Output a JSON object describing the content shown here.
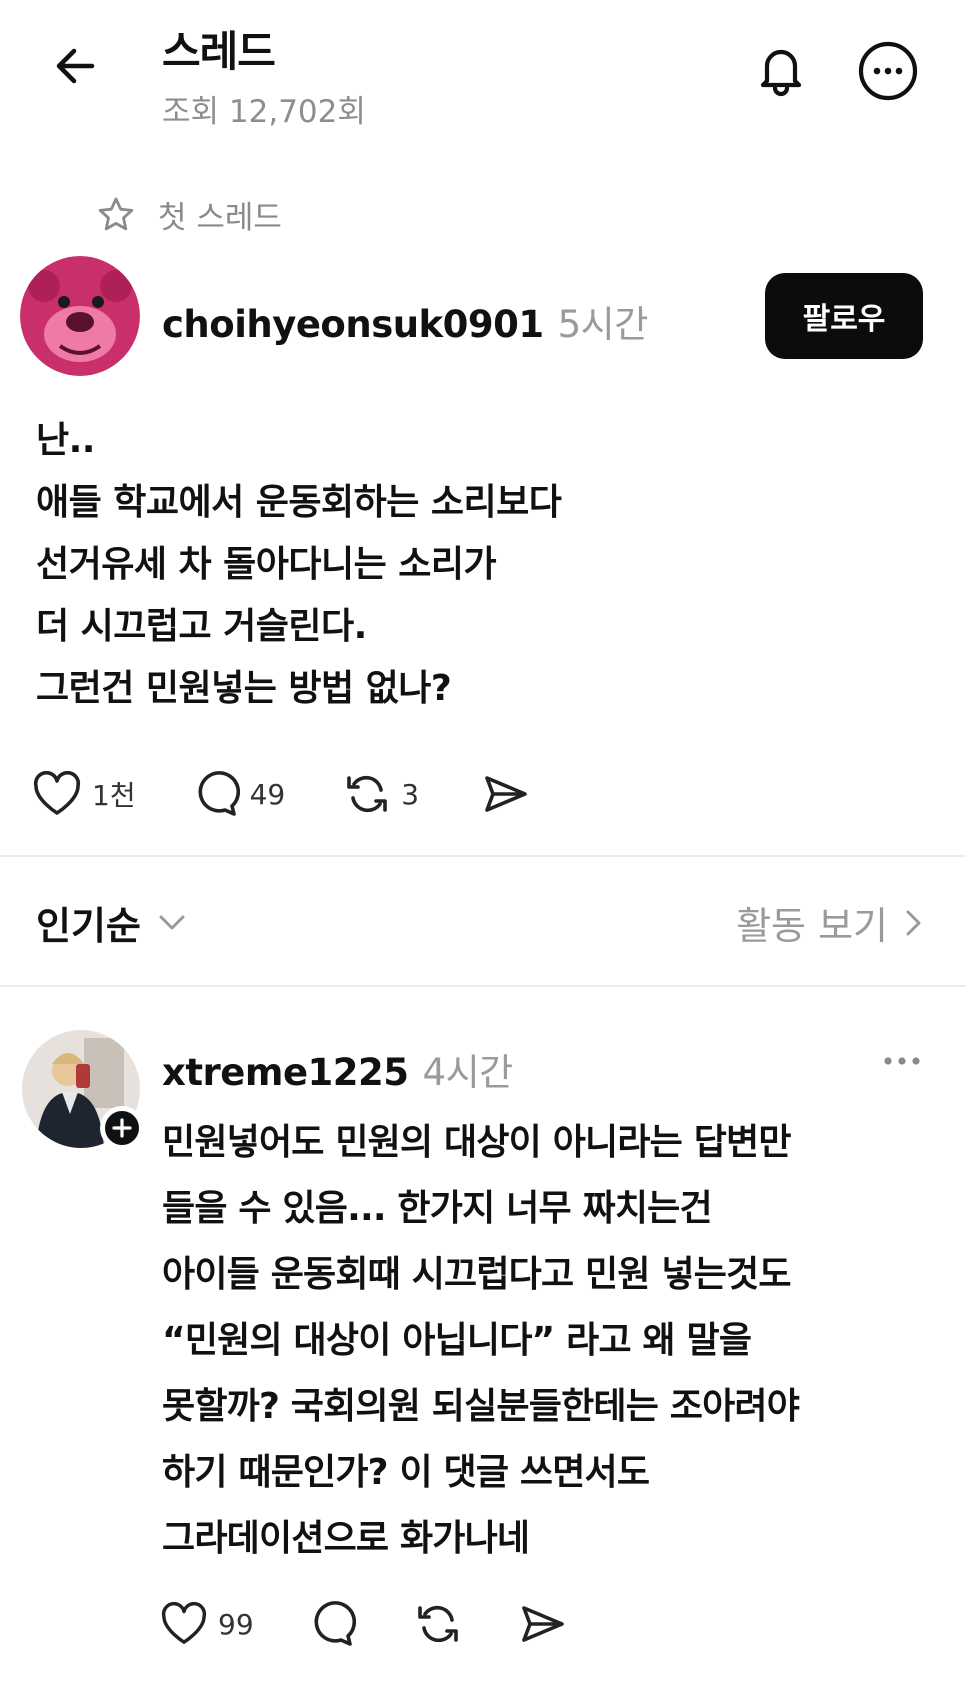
{
  "header": {
    "title": "스레드",
    "views": "조회 12,702회"
  },
  "first_thread": {
    "label": "첫 스레드"
  },
  "post": {
    "username": "choihyeonsuk0901",
    "time": "5시간",
    "follow_label": "팔로우",
    "lines": [
      "난..",
      "애들 학교에서 운동회하는 소리보다",
      "선거유세 차 돌아다니는 소리가",
      "더 시끄럽고 거슬린다.",
      "그런건 민원넣는 방법 없나?"
    ],
    "likes": "1천",
    "comments": "49",
    "reposts": "3"
  },
  "sort": {
    "label": "인기순",
    "activity_label": "활동 보기"
  },
  "reply": {
    "username": "xtreme1225",
    "time": "4시간",
    "lines": [
      "민원넣어도 민원의 대상이 아니라는 답변만",
      "들을 수 있음... 한가지 너무 짜치는건",
      "아이들 운동회때 시끄럽다고 민원 넣는것도",
      "“민원의 대상이 아닙니다”  라고 왜 말을",
      "못할까? 국회의원 되실분들한테는 조아려야",
      "하기 때문인가? 이 댓글 쓰면서도",
      "그라데이션으로 화가나네"
    ],
    "likes": "99"
  },
  "icons": {
    "back": "arrow-left-icon",
    "bell": "bell-icon",
    "more": "more-circle-icon",
    "star": "star-icon",
    "heart": "heart-icon",
    "comment": "comment-icon",
    "repost": "repost-icon",
    "share": "send-icon",
    "chevron_down": "chevron-down-icon",
    "chevron_right": "chevron-right-icon",
    "plus": "plus-icon",
    "kebab": "more-horizontal-icon"
  }
}
